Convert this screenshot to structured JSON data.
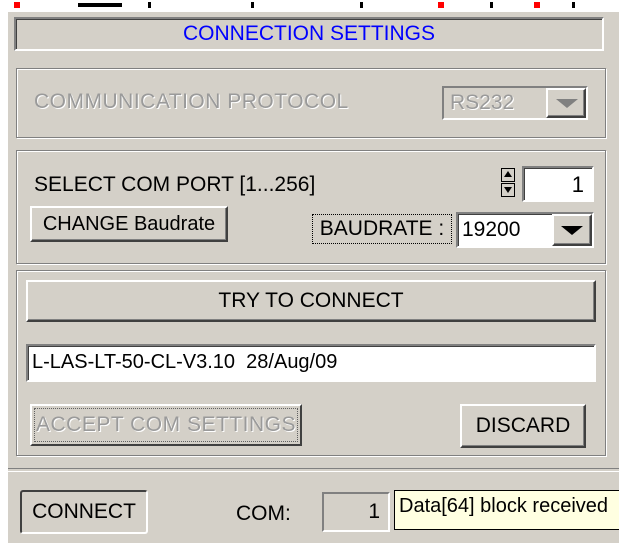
{
  "title": "CONNECTION SETTINGS",
  "protocol": {
    "label": "COMMUNICATION PROTOCOL",
    "value": "RS232"
  },
  "com_port": {
    "label": "SELECT COM PORT [1...256]",
    "value": "1"
  },
  "baud": {
    "change_button": "CHANGE Baudrate",
    "label": "BAUDRATE :",
    "value": "19200"
  },
  "connect_section": {
    "try_button": "TRY TO CONNECT",
    "status_text": "L-LAS-LT-50-CL-V3.10  28/Aug/09",
    "accept_button": "ACCEPT COM SETTINGS",
    "discard_button": "DISCARD"
  },
  "bottom_bar": {
    "connect_button": "CONNECT",
    "com_label": "COM:",
    "com_value": "1",
    "message": "Data[64] block received"
  },
  "colors": {
    "face": "#d4d0c8",
    "title_text": "#0000ff",
    "strip_red": "#ff0000"
  }
}
